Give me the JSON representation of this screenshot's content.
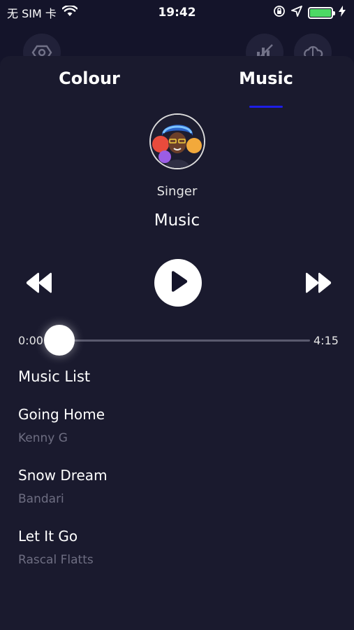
{
  "status_bar": {
    "carrier": "无 SIM 卡",
    "time": "19:42"
  },
  "icons": {
    "wifi": "wifi-icon",
    "orientation_lock": "orientation-lock-icon",
    "location": "location-arrow-icon",
    "battery": "battery-icon",
    "charging": "charging-bolt-icon",
    "settings": "settings-hexagon-icon",
    "equalizer": "equalizer-icon",
    "cloud": "cloud-icon"
  },
  "colors": {
    "background": "#14142a",
    "sheet": "#1a1a2e",
    "accent": "#1e1ee6",
    "battery": "#4cd964"
  },
  "battery_level": 1.0,
  "tabs": [
    {
      "label": "Colour",
      "selected": false
    },
    {
      "label": "Music",
      "selected": true
    }
  ],
  "player": {
    "singer": "Singer",
    "title": "Music",
    "current_time": "0:00",
    "total_time": "4:15",
    "progress": 0.0
  },
  "music_list": {
    "heading": "Music List",
    "items": [
      {
        "title": "Going Home",
        "artist": "Kenny G"
      },
      {
        "title": "Snow Dream",
        "artist": "Bandari"
      },
      {
        "title": "Let It Go",
        "artist": "Rascal Flatts"
      }
    ]
  }
}
